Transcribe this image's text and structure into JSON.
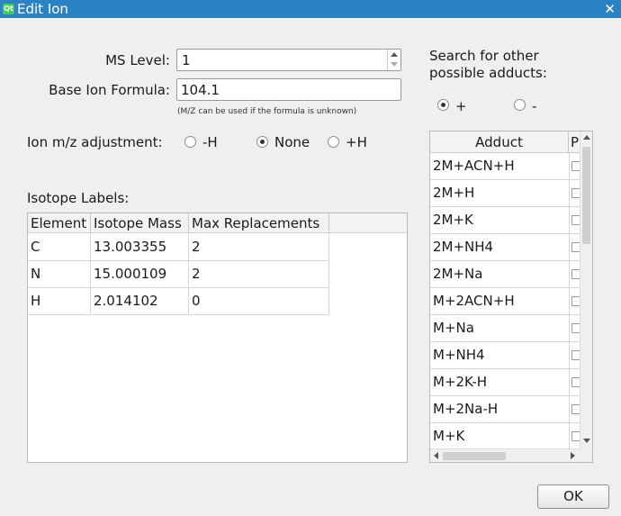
{
  "window": {
    "title": "Edit Ion",
    "app_icon": "qt-logo-icon",
    "close_glyph": "✕"
  },
  "ms_level": {
    "label": "MS Level:",
    "value": "1"
  },
  "base_formula": {
    "label": "Base Ion Formula:",
    "value": "104.1",
    "hint": "(M/Z can be used if the formula is unknown)"
  },
  "adjustment": {
    "label": "Ion m/z adjustment:",
    "options": [
      {
        "label": "-H",
        "checked": false
      },
      {
        "label": "None",
        "checked": true
      },
      {
        "label": "+H",
        "checked": false
      }
    ]
  },
  "isotope": {
    "label": "Isotope Labels:",
    "columns": [
      "Element",
      "Isotope Mass",
      "Max Replacements"
    ],
    "rows": [
      [
        "C",
        "13.003355",
        "2"
      ],
      [
        "N",
        "15.000109",
        "2"
      ],
      [
        "H",
        "2.014102",
        "0"
      ]
    ]
  },
  "adducts": {
    "label_line1": "Search for other",
    "label_line2": "possible adducts:",
    "polarity": [
      {
        "label": "+",
        "checked": true
      },
      {
        "label": "-",
        "checked": false
      }
    ],
    "columns": [
      "Adduct",
      "P"
    ],
    "rows": [
      "2M+ACN+H",
      "2M+H",
      "2M+K",
      "2M+NH4",
      "2M+Na",
      "M+2ACN+H",
      "M+Na",
      "M+NH4",
      "M+2K-H",
      "M+2Na-H",
      "M+K"
    ]
  },
  "ok_label": "OK"
}
